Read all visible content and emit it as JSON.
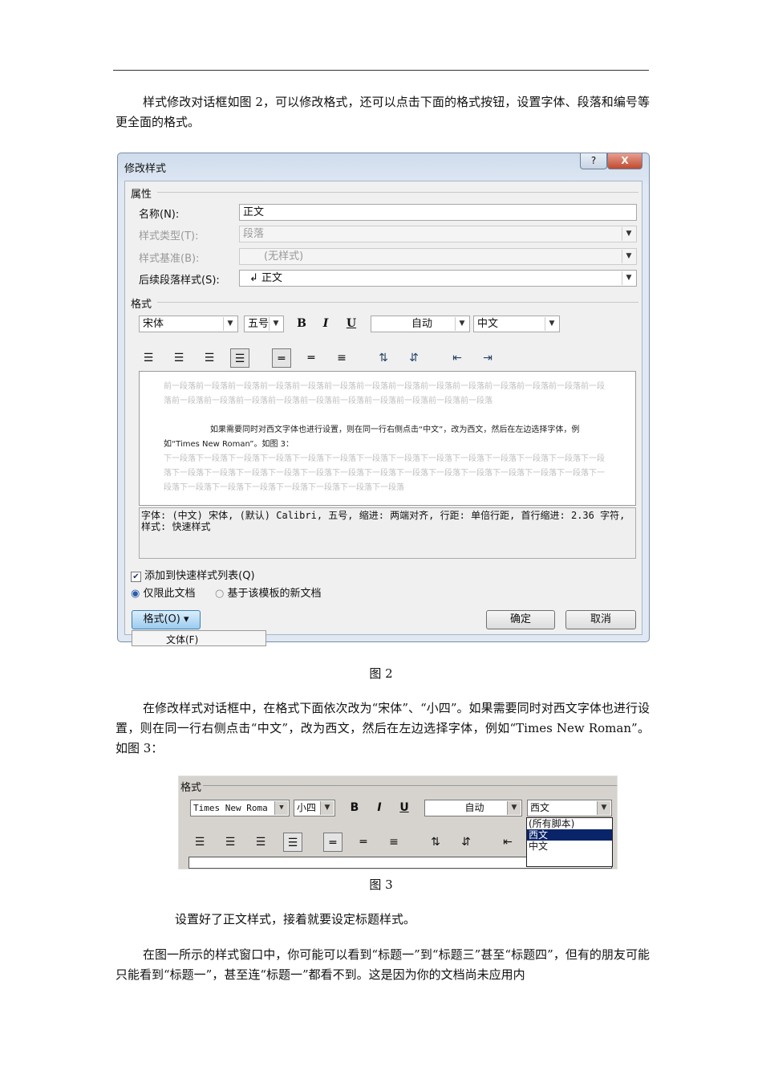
{
  "paragraphs": {
    "p1": "样式修改对话框如图 2，可以修改格式，还可以点击下面的格式按钮，设置字体、段落和编号等更全面的格式。",
    "p2": "在修改样式对话框中，在格式下面依次改为“宋体”、“小四”。如果需要同时对西文字体也进行设置，则在同一行右侧点击“中文”，改为西文，然后在左边选择字体，例如“Times New Roman”。如图 3：",
    "p3": "设置好了正文样式，接着就要设定标题样式。",
    "p4": "在图一所示的样式窗口中，你可能可以看到“标题一”到“标题三”甚至“标题四”，但有的朋友可能只能看到“标题一”，甚至连“标题一”都看不到。这是因为你的文档尚未应用内"
  },
  "captions": {
    "fig2": "图 2",
    "fig3": "图 3"
  },
  "dialog": {
    "title": "修改样式",
    "help": "?",
    "close": "X",
    "props_header": "属性",
    "name_label": "名称(N):",
    "name_value": "正文",
    "type_label": "样式类型(T):",
    "type_value": "段落",
    "base_label": "样式基准(B):",
    "base_value": "(无样式)",
    "next_label": "后续段落样式(S):",
    "next_value": "↲ 正文",
    "format_header": "格式",
    "font": "宋体",
    "size": "五号",
    "bold": "B",
    "italic": "I",
    "underline": "U",
    "color": "自动",
    "script": "中文",
    "preview_before": "前一段落前一段落前一段落前一段落前一段落前一段落前一段落前一段落前一段落前一段落前一段落前一段落前一段落前一段落前一段落前一段落前一段落前一段落前一段落前一段落前一段落前一段落前一段落前一段落",
    "preview_main": "如果需要同时对西文字体也进行设置，则在同一行右侧点击“中文”，改为西文，然后在左边选择字体，例如“Times New Roman”。如图 3：",
    "preview_after": "下一段落下一段落下一段落下一段落下一段落下一段落下一段落下一段落下一段落下一段落下一段落下一段落下一段落下一段落下一段落下一段落下一段落下一段落下一段落下一段落下一段落下一段落下一段落下一段落下一段落下一段落下一段落下一段落下一段落下一段落下一段落下一段落下一段落下一段落下一段落",
    "description": "字体: (中文) 宋体, (默认) Calibri, 五号, 缩进: 两端对齐, 行距: 单倍行距, 首行缩进: 2.36 字符, 样式: 快速样式",
    "add_quick": "添加到快速样式列表(Q)",
    "only_doc": "仅限此文档",
    "template": "基于该模板的新文档",
    "format_btn": "格式(O) ▾",
    "ok": "确定",
    "cancel": "取消",
    "menu_font": "文体(F)"
  },
  "fig3": {
    "header": "格式",
    "font": "Times New Roma",
    "size": "小四",
    "bold": "B",
    "italic": "I",
    "underline": "U",
    "color": "自动",
    "script": "西文",
    "options": [
      "(所有脚本)",
      "西文",
      "中文"
    ]
  }
}
